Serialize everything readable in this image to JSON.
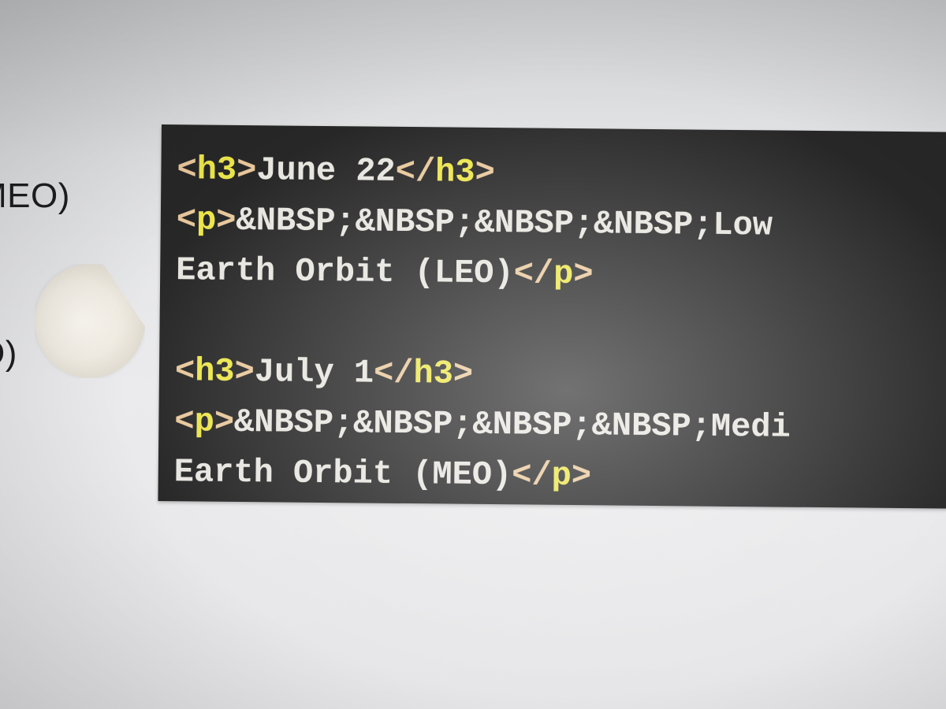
{
  "colors": {
    "panel_background": "#272727",
    "tag_bracket": "#e9c79a",
    "tag_name": "#ece54a",
    "text": "#e7e5df",
    "page_background": "#e6e6e8"
  },
  "sidebar": {
    "label_1": "MEO)",
    "label_2": "O)",
    "avatar_icon": "moon-icon"
  },
  "code": {
    "line1": {
      "open_lt": "<",
      "open_tag": "h3",
      "open_gt": ">",
      "text": "June 22",
      "close_lt": "</",
      "close_tag": "h3",
      "close_gt": ">"
    },
    "line2": {
      "open_lt": "<",
      "open_tag": "p",
      "open_gt": ">",
      "text": "&NBSP;&NBSP;&NBSP;&NBSP;Low"
    },
    "line3": {
      "text": "Earth Orbit (LEO)",
      "close_lt": "</",
      "close_tag": "p",
      "close_gt": ">"
    },
    "line4": {
      "open_lt": "<",
      "open_tag": "h3",
      "open_gt": ">",
      "text": "July 1",
      "close_lt": "</",
      "close_tag": "h3",
      "close_gt": ">"
    },
    "line5": {
      "open_lt": "<",
      "open_tag": "p",
      "open_gt": ">",
      "text": "&NBSP;&NBSP;&NBSP;&NBSP;Medi"
    },
    "line6": {
      "text": "Earth Orbit (MEO)",
      "close_lt": "</",
      "close_tag": "p",
      "close_gt": ">"
    }
  }
}
